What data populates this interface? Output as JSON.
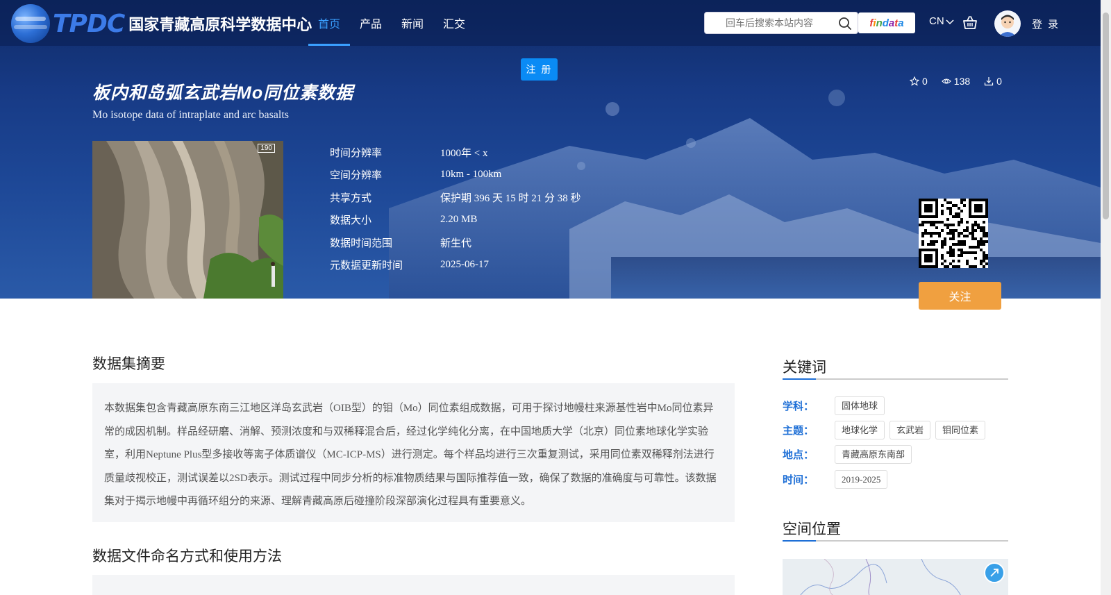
{
  "header": {
    "logo_abbr": "TPDC",
    "logo_name": "国家青藏高原科学数据中心",
    "nav": [
      {
        "label": "首页",
        "active": true
      },
      {
        "label": "产品",
        "active": false
      },
      {
        "label": "新闻",
        "active": false
      },
      {
        "label": "汇交",
        "active": false
      }
    ],
    "search_placeholder": "回车后搜索本站内容",
    "findata_letters": [
      "f",
      "i",
      "n",
      "d",
      "a",
      "t",
      "a"
    ],
    "lang": "CN",
    "login_label": "登 录"
  },
  "register_label": "注 册",
  "dataset": {
    "title_cn": "板内和岛弧玄武岩Mo同位素数据",
    "title_en": "Mo isotope data of intraplate and arc basalts",
    "stats": {
      "stars": "0",
      "views": "138",
      "downloads": "0"
    },
    "thumb_badge": "190",
    "meta": [
      {
        "key": "时间分辨率",
        "value": "1000年 < x"
      },
      {
        "key": "空间分辨率",
        "value": "10km - 100km"
      },
      {
        "key": "共享方式",
        "value": "保护期 396 天 15 时 21 分 38 秒"
      },
      {
        "key": "数据大小",
        "value": "2.20 MB"
      },
      {
        "key": "数据时间范围",
        "value": "新生代"
      },
      {
        "key": "元数据更新时间",
        "value": "2025-06-17"
      }
    ],
    "follow_label": "关注"
  },
  "abstract": {
    "title": "数据集摘要",
    "text": "本数据集包含青藏高原东南三江地区洋岛玄武岩（OIB型）的钼（Mo）同位素组成数据，可用于探讨地幔柱来源基性岩中Mo同位素异常的成因机制。样品经研磨、消解、预测浓度和与双稀释混合后，经过化学纯化分离，在中国地质大学（北京）同位素地球化学实验室，利用Neptune Plus型多接收等离子体质谱仪（MC-ICP-MS）进行测定。每个样品均进行三次重复测试，采用同位素双稀释剂法进行质量歧视校正，测试误差以2SD表示。测试过程中同步分析的标准物质结果与国际推荐值一致，确保了数据的准确度与可靠性。该数据集对于揭示地幔中再循环组分的来源、理解青藏高原后碰撞阶段深部演化过程具有重要意义。"
  },
  "usage": {
    "title": "数据文件命名方式和使用方法"
  },
  "keywords": {
    "title": "关键词",
    "rows": [
      {
        "label": "学科：",
        "tags": [
          "固体地球"
        ]
      },
      {
        "label": "主题：",
        "tags": [
          "地球化学",
          "玄武岩",
          "钼同位素"
        ]
      },
      {
        "label": "地点：",
        "tags": [
          "青藏高原东南部"
        ]
      },
      {
        "label": "时间：",
        "tags": [
          "2019-2025"
        ]
      }
    ]
  },
  "location": {
    "title": "空间位置"
  },
  "colors": {
    "accent": "#3aa0ff",
    "follow": "#f0a040",
    "register": "#0a8bf5",
    "keyword_label": "#1e6fd6"
  }
}
